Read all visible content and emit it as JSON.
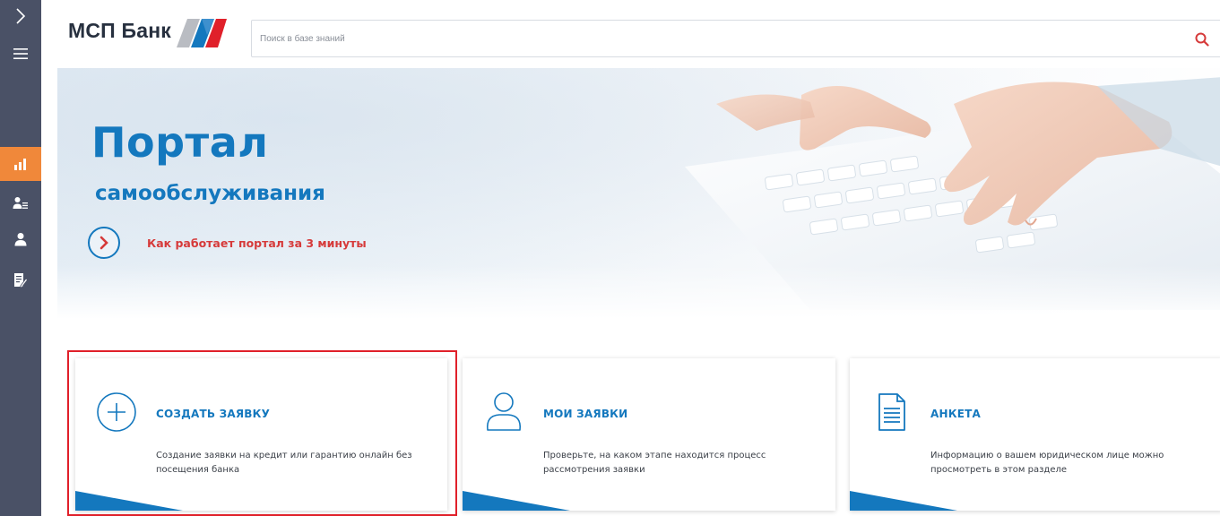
{
  "sidebar": {
    "items": [
      {
        "name": "expand",
        "icon": "chevron-right-icon"
      },
      {
        "name": "menu",
        "icon": "hamburger-menu-icon"
      },
      {
        "name": "dashboard",
        "icon": "bar-chart-icon",
        "active": true
      },
      {
        "name": "clients",
        "icon": "user-list-icon"
      },
      {
        "name": "profile",
        "icon": "user-icon"
      },
      {
        "name": "documents",
        "icon": "edit-document-icon"
      }
    ],
    "colors": {
      "background": "#4a5166",
      "active": "#f0883a"
    }
  },
  "header": {
    "logo_text": "МСП Банк",
    "search": {
      "placeholder": "Поиск в базе знаний",
      "value": "",
      "icon": "search-icon"
    }
  },
  "hero": {
    "title": "Портал",
    "subtitle": "самообслуживания",
    "video_link": "Как работает портал за 3 минуты",
    "video_icon": "play-chevron-icon"
  },
  "cards": [
    {
      "title": "СОЗДАТЬ ЗАЯВКУ",
      "description": "Создание заявки на кредит или гарантию онлайн без посещения банка",
      "icon": "plus-circle-icon",
      "highlighted": true
    },
    {
      "title": "МОИ ЗАЯВКИ",
      "description": "Проверьте, на каком этапе находится процесс рассмотрения заявки",
      "icon": "user-outline-icon"
    },
    {
      "title": "АНКЕТА",
      "description": "Информацию о вашем юридическом лице можно просмотреть в этом разделе",
      "icon": "document-icon"
    }
  ],
  "colors": {
    "brand_blue": "#1478be",
    "accent_red": "#d63a3a",
    "highlight_red": "#e0202a"
  }
}
